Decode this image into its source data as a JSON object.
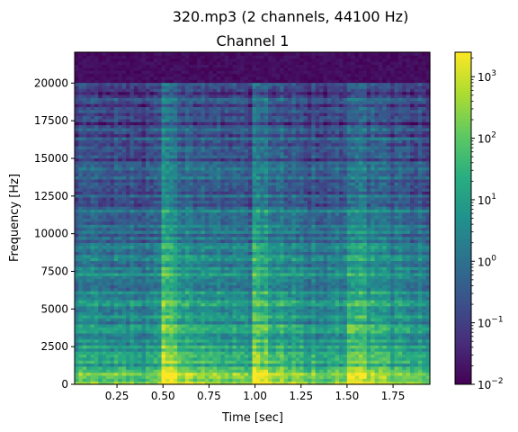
{
  "figure": {
    "suptitle": "320.mp3 (2 channels, 44100 Hz)"
  },
  "chart_data": {
    "type": "heatmap",
    "title": "Channel 1",
    "xlabel": "Time [sec]",
    "ylabel": "Frequency [Hz]",
    "xlim": [
      0.02,
      1.95
    ],
    "ylim": [
      0,
      22050
    ],
    "xticks": [
      0.25,
      0.5,
      0.75,
      1.0,
      1.25,
      1.5,
      1.75
    ],
    "xtick_labels": [
      "0.25",
      "0.50",
      "0.75",
      "1.00",
      "1.25",
      "1.50",
      "1.75"
    ],
    "yticks": [
      0,
      2500,
      5000,
      7500,
      10000,
      12500,
      15000,
      17500,
      20000
    ],
    "ytick_labels": [
      "0",
      "2500",
      "5000",
      "7500",
      "10000",
      "12500",
      "15000",
      "17500",
      "20000"
    ],
    "colormap": "viridis",
    "colorbar": {
      "scale": "log",
      "range": [
        0.01,
        2500
      ],
      "ticks": [
        0.01,
        0.1,
        1,
        10,
        100,
        1000
      ],
      "tick_base": [
        "10",
        "10",
        "10",
        "10",
        "10",
        "10"
      ],
      "tick_exp": [
        "−2",
        "−1",
        "0",
        "1",
        "2",
        "3"
      ]
    },
    "cutoff_frequency_hz": 20000,
    "onset_times_sec": [
      0.5,
      1.0,
      1.5
    ],
    "grid": false
  }
}
